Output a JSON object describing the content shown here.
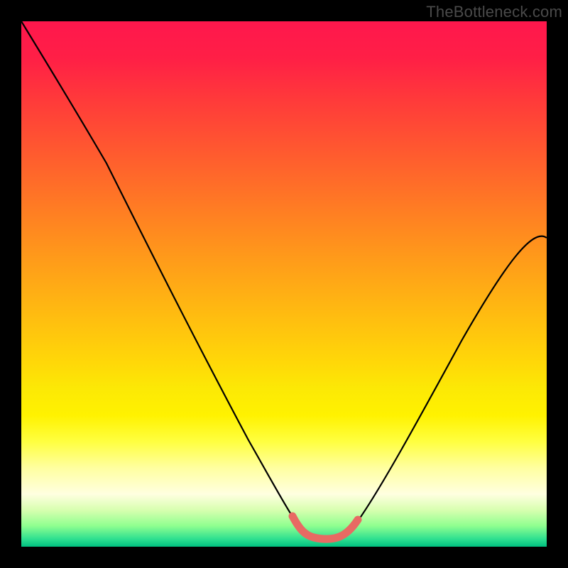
{
  "attribution": "TheBottleneck.com",
  "colors": {
    "frame_bg": "#000000",
    "curve_stroke": "#000000",
    "accent_stroke": "#e86a63",
    "gradient_top": "#ff174d",
    "gradient_bottom": "#00c080"
  },
  "chart_data": {
    "type": "line",
    "title": "",
    "xlabel": "",
    "ylabel": "",
    "xlim": [
      0,
      100
    ],
    "ylim": [
      0,
      100
    ],
    "grid": false,
    "legend": false,
    "series": [
      {
        "name": "bottleneck-curve",
        "x": [
          0,
          5,
          10,
          15,
          20,
          25,
          30,
          35,
          40,
          45,
          50,
          52,
          54,
          56,
          58,
          60,
          62,
          65,
          70,
          75,
          80,
          85,
          90,
          95,
          100
        ],
        "y": [
          100,
          93,
          86,
          78,
          70,
          62,
          53,
          44,
          34,
          24,
          13,
          7,
          3,
          1,
          0,
          0,
          0,
          3,
          12,
          22,
          32,
          41,
          48,
          54,
          59
        ]
      }
    ],
    "annotations": [
      {
        "name": "optimal-range",
        "x_start": 51,
        "x_end": 63,
        "note": "highlighted salmon segment at curve minimum"
      }
    ]
  }
}
